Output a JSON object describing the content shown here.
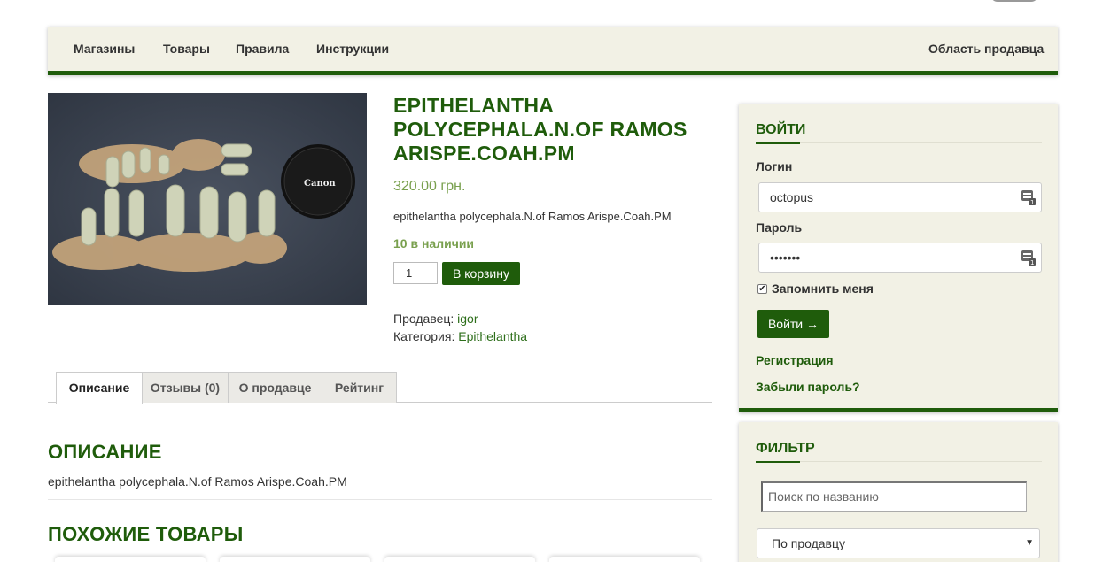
{
  "nav": {
    "items": [
      "Магазины",
      "Товары",
      "Правила",
      "Инструкции"
    ],
    "seller_area": "Область продавца"
  },
  "product": {
    "title": "EPITHELANTHA POLYCEPHALA.N.OF RAMOS ARISPE.COAH.PM",
    "price": "320.00 грн.",
    "short_description": "epithelantha polycephala.N.of Ramos Arispe.Coah.PM",
    "stock": "10 в наличии",
    "quantity": "1",
    "add_to_cart": "В корзину",
    "seller_label": "Продавец:",
    "seller_name": "igor",
    "category_label": "Категория:",
    "category_name": "Epithelantha",
    "image_brand_text": "Canon"
  },
  "tabs": [
    "Описание",
    "Отзывы (0)",
    "О продавце",
    "Рейтинг"
  ],
  "description": {
    "heading": "ОПИСАНИЕ",
    "text": "epithelantha polycephala.N.of Ramos Arispe.Coah.PM"
  },
  "similar": {
    "heading": "ПОХОЖИЕ ТОВАРЫ"
  },
  "login": {
    "title": "ВОЙТИ",
    "login_label": "Логин",
    "login_value": "octopus",
    "password_label": "Пароль",
    "password_value": "•••••••",
    "remember_label": "Запомнить меня",
    "remember_checked": true,
    "submit": "Войти →",
    "register": "Регистрация",
    "forgot": "Забыли пароль?"
  },
  "filter": {
    "title": "ФИЛЬТР",
    "search_placeholder": "Поиск по названию",
    "seller_select": "По продавцу"
  },
  "colors": {
    "accent_green": "#1f5c0b",
    "light_green": "#79a04e",
    "panel_bg": "#f2f1e5"
  }
}
